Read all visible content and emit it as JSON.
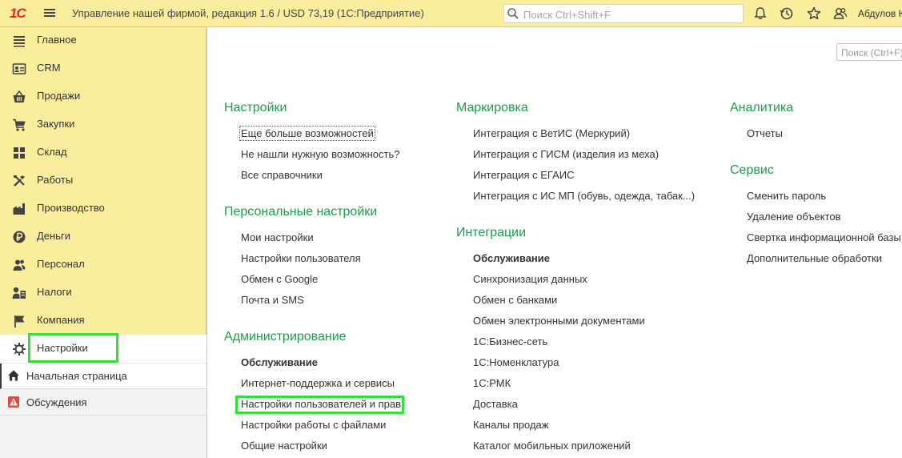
{
  "topbar": {
    "logo_text": "1С",
    "title": "Управление нашей фирмой, редакция 1.6 / USD 73,19  (1С:Предприятие)",
    "search_placeholder": "Поиск Ctrl+Shift+F",
    "user_name": "Абдулов Ю",
    "icons": [
      "menu-icon",
      "bell-icon",
      "history-icon",
      "star-icon",
      "users-icon"
    ]
  },
  "sidebar": {
    "items": [
      {
        "label": "Главное",
        "icon": "list-icon"
      },
      {
        "label": "CRM",
        "icon": "contact-card-icon"
      },
      {
        "label": "Продажи",
        "icon": "basket-icon"
      },
      {
        "label": "Закупки",
        "icon": "cart-icon"
      },
      {
        "label": "Склад",
        "icon": "warehouse-grid-icon"
      },
      {
        "label": "Работы",
        "icon": "tools-icon"
      },
      {
        "label": "Производство",
        "icon": "factory-icon"
      },
      {
        "label": "Деньги",
        "icon": "ruble-coin-icon"
      },
      {
        "label": "Персонал",
        "icon": "people-icon"
      },
      {
        "label": "Налоги",
        "icon": "tax-icon"
      },
      {
        "label": "Компания",
        "icon": "flag-icon"
      },
      {
        "label": "Настройки",
        "icon": "gear-icon"
      }
    ],
    "active_index": 11,
    "lower": [
      {
        "label": "Начальная страница",
        "icon": "home-icon"
      },
      {
        "label": "Обсуждения",
        "icon": "warning-chat-icon"
      }
    ]
  },
  "content": {
    "search_placeholder": "Поиск (Ctrl+F)",
    "columns": [
      {
        "groups": [
          {
            "title": "Настройки",
            "links": [
              {
                "text": "Еще больше возможностей",
                "focused": true
              },
              {
                "text": "Не нашли нужную возможность?"
              },
              {
                "text": "Все справочники"
              }
            ]
          },
          {
            "title": "Персональные настройки",
            "links": [
              {
                "text": "Мои настройки"
              },
              {
                "text": "Настройки пользователя"
              },
              {
                "text": "Обмен с Google"
              },
              {
                "text": "Почта и SMS"
              }
            ]
          },
          {
            "title": "Администрирование",
            "links": [
              {
                "text": "Обслуживание",
                "bold": true
              },
              {
                "text": "Интернет-поддержка и сервисы"
              },
              {
                "text": "Настройки пользователей и прав",
                "highlighted": true
              },
              {
                "text": "Настройки работы с файлами"
              },
              {
                "text": "Общие настройки"
              }
            ]
          }
        ]
      },
      {
        "groups": [
          {
            "title": "Маркировка",
            "links": [
              {
                "text": "Интеграция с ВетИС (Меркурий)"
              },
              {
                "text": "Интеграция с ГИСМ (изделия из меха)"
              },
              {
                "text": "Интеграция с ЕГАИС"
              },
              {
                "text": "Интеграция с ИС МП (обувь, одежда, табак...)"
              }
            ]
          },
          {
            "title": "Интеграции",
            "links": [
              {
                "text": "Обслуживание",
                "bold": true
              },
              {
                "text": "Синхронизация данных"
              },
              {
                "text": "Обмен с банками"
              },
              {
                "text": "Обмен электронными документами"
              },
              {
                "text": "1С:Бизнес-сеть"
              },
              {
                "text": "1С:Номенклатура"
              },
              {
                "text": "1С:РМК"
              },
              {
                "text": "Доставка"
              },
              {
                "text": "Каналы продаж"
              },
              {
                "text": "Каталог мобильных приложений"
              }
            ]
          }
        ]
      },
      {
        "groups": [
          {
            "title": "Аналитика",
            "links": [
              {
                "text": "Отчеты"
              }
            ]
          },
          {
            "title": "Сервис",
            "links": [
              {
                "text": "Сменить пароль"
              },
              {
                "text": "Удаление объектов"
              },
              {
                "text": "Свертка информационной базы"
              },
              {
                "text": "Дополнительные обработки"
              }
            ]
          }
        ]
      }
    ]
  },
  "colors": {
    "sidebar_bg": "#fbed9e",
    "group_title": "#1c9d4b",
    "highlight_box": "#33e033",
    "logo": "#e0261a"
  }
}
